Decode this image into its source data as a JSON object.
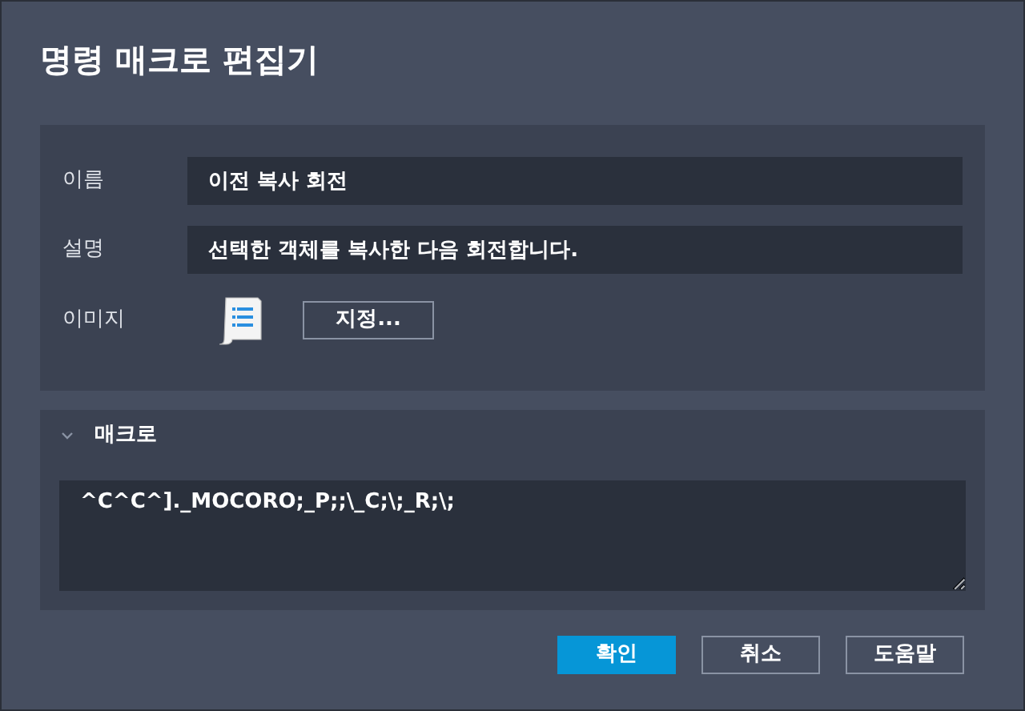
{
  "window": {
    "title": "명령 매크로 편집기"
  },
  "fields": [
    {
      "label": "이름",
      "value": "이전 복사 회전"
    },
    {
      "label": "설명",
      "value": "선택한 객체를 복사한 다음 회전합니다."
    }
  ],
  "image": {
    "label": "이미지",
    "button": "지정..."
  },
  "macro": {
    "title": "매크로",
    "expanded": true,
    "value": "^C^C^]._MOCORO;_P;;\\_C;\\;_R;\\;"
  },
  "buttons": [
    {
      "label": "확인",
      "primary": true
    },
    {
      "label": "취소",
      "primary": false
    },
    {
      "label": "도움말",
      "primary": false
    }
  ]
}
